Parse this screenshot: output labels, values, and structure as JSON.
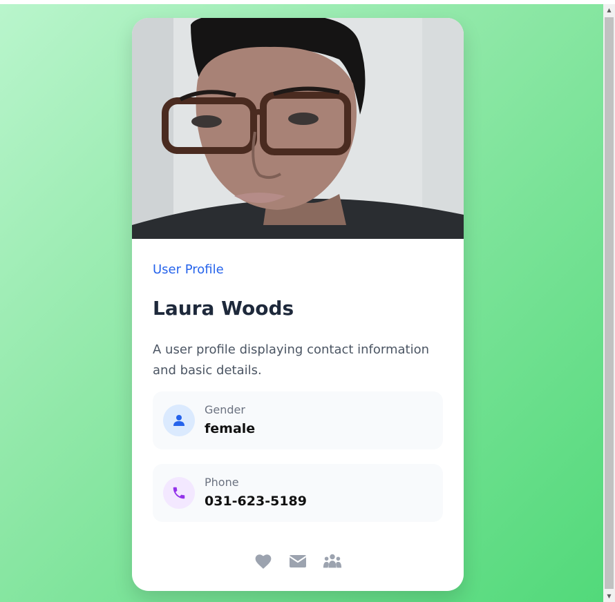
{
  "profile": {
    "eyebrow": "User Profile",
    "name": "Laura Woods",
    "description": "A user profile displaying contact information and basic details."
  },
  "details": {
    "gender": {
      "label": "Gender",
      "value": "female",
      "icon": "user-icon"
    },
    "phone": {
      "label": "Phone",
      "value": "031-623-5189",
      "icon": "phone-icon"
    }
  },
  "actions": [
    {
      "icon": "heart-icon"
    },
    {
      "icon": "envelope-icon"
    },
    {
      "icon": "users-icon"
    }
  ],
  "colors": {
    "accent_blue": "#2563eb",
    "accent_purple": "#9333ea",
    "action_gray": "#9ca3af",
    "background_start": "#b9f5cc",
    "background_end": "#52d97a"
  }
}
